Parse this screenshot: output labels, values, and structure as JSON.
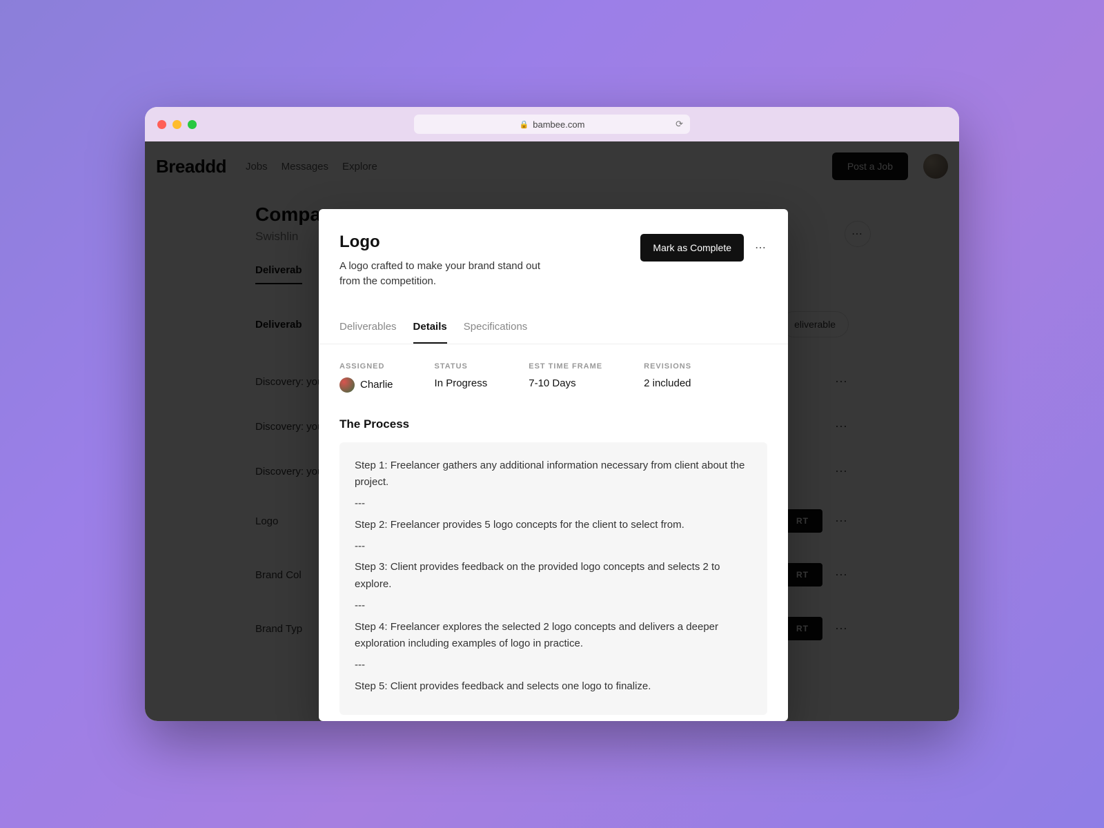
{
  "browser": {
    "url": "bambee.com"
  },
  "nav": {
    "logo": "Breaddd",
    "links": [
      "Jobs",
      "Messages",
      "Explore"
    ],
    "post_job": "Post a Job"
  },
  "page": {
    "title": "Compa",
    "subtitle": "Swishlin",
    "active_tab": "Deliverab",
    "deliv_header": "Deliverab",
    "add_button": "eliverable",
    "rows": [
      {
        "title": "Discovery:\nyour comp"
      },
      {
        "title": "Discovery:\nyour custo"
      },
      {
        "title": "Discovery:\nyour tone"
      },
      {
        "title": "Logo",
        "action": "RT"
      },
      {
        "title": "Brand Col",
        "action": "RT"
      },
      {
        "title": "Brand Typ",
        "action": "RT"
      }
    ]
  },
  "modal": {
    "title": "Logo",
    "description": "A logo crafted to make your brand stand out from the competition.",
    "mark_complete": "Mark as Complete",
    "tabs": [
      "Deliverables",
      "Details",
      "Specifications"
    ],
    "active_tab": 1,
    "meta": {
      "assigned_label": "ASSIGNED",
      "assigned_value": "Charlie",
      "status_label": "STATUS",
      "status_value": "In Progress",
      "time_label": "EST TIME FRAME",
      "time_value": "7-10 Days",
      "revisions_label": "REVISIONS",
      "revisions_value": "2 included"
    },
    "process_title": "The Process",
    "process_steps": [
      "Step 1: Freelancer gathers any additional information necessary from client about the project.",
      "---",
      "Step 2: Freelancer provides 5 logo concepts for the client to select from.",
      "---",
      "Step 3: Client provides feedback on the provided logo concepts and selects 2 to explore.",
      "---",
      "Step 4: Freelancer explores the selected 2 logo concepts and delivers a deeper exploration including examples of logo in practice.",
      "---",
      "Step 5: Client provides feedback and selects one logo to finalize."
    ]
  }
}
